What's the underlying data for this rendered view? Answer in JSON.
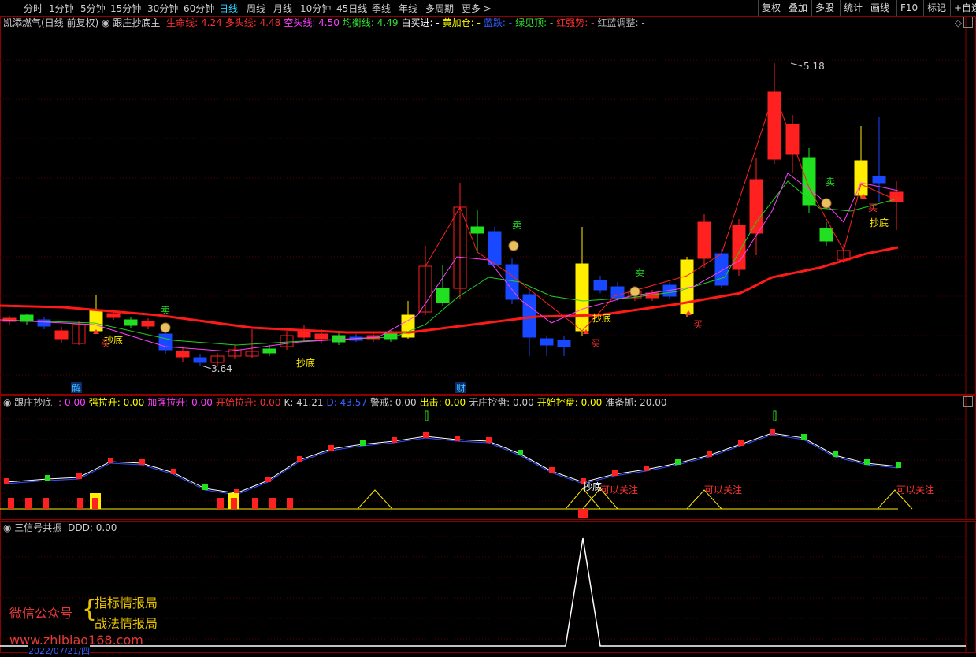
{
  "toolbar": {
    "periods": [
      "分时",
      "1分钟",
      "5分钟",
      "15分钟",
      "30分钟",
      "60分钟",
      "日线",
      "周线",
      "月线",
      "10分钟",
      "45日线",
      "季线",
      "年线",
      "多周期",
      "更多 >"
    ],
    "active_period": "日线",
    "right_buttons": [
      "复权",
      "叠加",
      "多股",
      "统计",
      "画线",
      "F10",
      "标记",
      "+自选"
    ]
  },
  "main_panel": {
    "stock_title": "凯添燃气(日线 前复权)",
    "indicator_name": "跟庄抄底主",
    "values": [
      {
        "label": "生命线:",
        "value": "4.24",
        "color": "#ff3030"
      },
      {
        "label": "多头线:",
        "value": "4.48",
        "color": "#ff3030"
      },
      {
        "label": "空头线:",
        "value": "4.50",
        "color": "#ff40ff"
      },
      {
        "label": "均衡线:",
        "value": "4.49",
        "color": "#30e030"
      },
      {
        "label": "白买进:",
        "value": "-",
        "color": "#ffffff"
      },
      {
        "label": "黄加仓:",
        "value": "-",
        "color": "#ffff00"
      },
      {
        "label": "蓝跌:",
        "value": "-",
        "color": "#3060ff"
      },
      {
        "label": "绿见顶:",
        "value": "-",
        "color": "#30e030"
      },
      {
        "label": "红强势:",
        "value": "-",
        "color": "#ff3030"
      },
      {
        "label": "红蓝调整:",
        "value": "-",
        "color": "#b0b0b0"
      }
    ],
    "annotations": {
      "high_price": "5.18",
      "low_price": "3.64",
      "sell": "卖",
      "buy": "买",
      "bottom": "抄底",
      "jie": "解",
      "cai": "财"
    }
  },
  "sub_panel_1": {
    "indicator_name": "跟庄抄底",
    "values": [
      {
        "label": ":",
        "value": "0.00",
        "color": "#ff40ff"
      },
      {
        "label": "强拉升:",
        "value": "0.00",
        "color": "#ffff00"
      },
      {
        "label": "加强拉升:",
        "value": "0.00",
        "color": "#ff40ff"
      },
      {
        "label": "开始拉升:",
        "value": "0.00",
        "color": "#ff3030"
      },
      {
        "label": "K:",
        "value": "41.21",
        "color": "#d0d0d0"
      },
      {
        "label": "D:",
        "value": "43.57",
        "color": "#3060ff"
      },
      {
        "label": "警戒:",
        "value": "0.00",
        "color": "#d0d0d0"
      },
      {
        "label": "出击:",
        "value": "0.00",
        "color": "#ffff00"
      },
      {
        "label": "无庄控盘:",
        "value": "0.00",
        "color": "#d0d0d0"
      },
      {
        "label": "开始控盘:",
        "value": "0.00",
        "color": "#ffff00"
      },
      {
        "label": "准备抓:",
        "value": "20.00",
        "color": "#d0d0d0"
      }
    ],
    "annotations": {
      "bottom": "抄底",
      "watch": "可以关注"
    }
  },
  "sub_panel_2": {
    "indicator_name": "三信号共振",
    "values": [
      {
        "label": "DDD:",
        "value": "0.00",
        "color": "#d0d0d0"
      }
    ]
  },
  "watermark": {
    "wechat": "微信公众号",
    "line1": "指标情报局",
    "line2": "战法情报局",
    "url": "www.zhibiao168.com",
    "date": "2022/07/21/四"
  },
  "colors": {
    "up": "#ff2020",
    "down_blue": "#1030ff",
    "green": "#20e020",
    "yellow": "#ffee00",
    "border": "#8b0000"
  }
}
